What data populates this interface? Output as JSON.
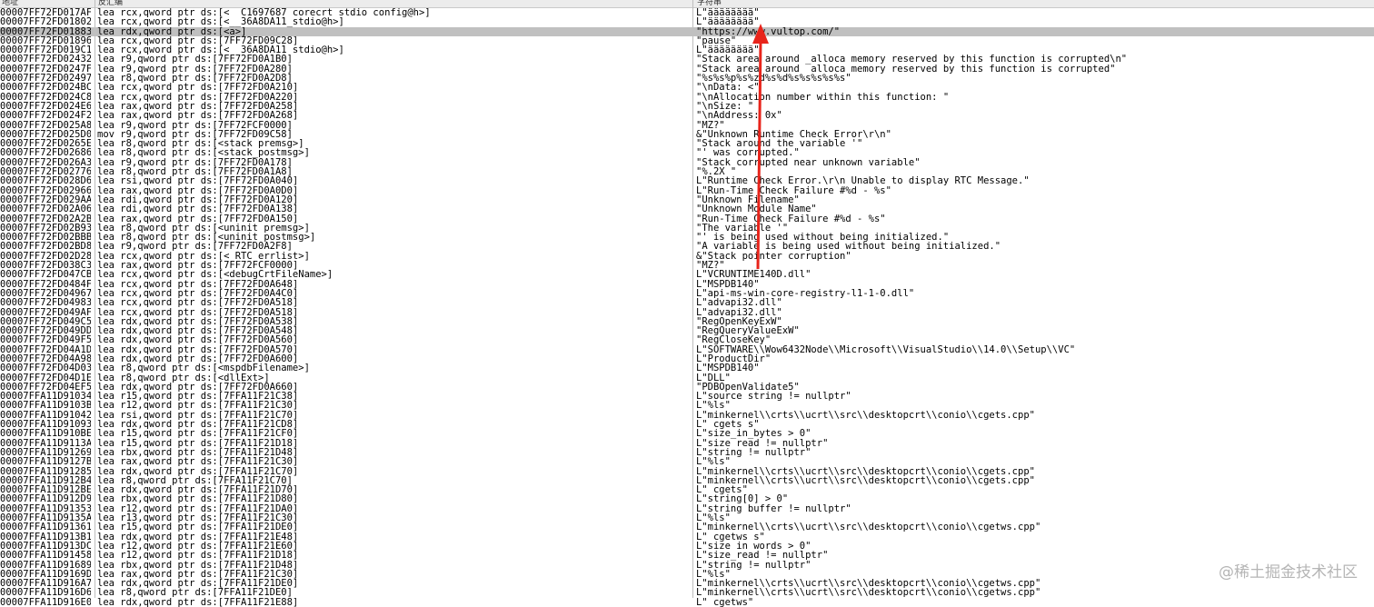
{
  "header": {
    "col_addr": "地址",
    "col_disasm": "反汇编",
    "col_string": "字符串"
  },
  "colors": {
    "selected_row": "#c0c0c0",
    "arrow": "#e8241b"
  },
  "selected_index": 2,
  "rows": [
    {
      "addr": "00007FF72FD017AF",
      "instr": "lea rcx,qword ptr ds:[<__C1697687_corecrt_stdio_config@h>]",
      "str": "L\"ääääääää\""
    },
    {
      "addr": "00007FF72FD01802",
      "instr": "lea rcx,qword ptr ds:[<__36A8DA11_stdio@h>]",
      "str": "L\"ääääääää\""
    },
    {
      "addr": "00007FF72FD01883",
      "instr": "lea rdx,qword ptr ds:[<a>]",
      "str": "\"https://www.vultop.com/\""
    },
    {
      "addr": "00007FF72FD01896",
      "instr": "lea rcx,qword ptr ds:[7FF72FD09C28]",
      "str": "\"pause\""
    },
    {
      "addr": "00007FF72FD019C1",
      "instr": "lea rcx,qword ptr ds:[<__36A8DA11_stdio@h>]",
      "str": "L\"ääääääää\""
    },
    {
      "addr": "00007FF72FD02432",
      "instr": "lea r9,qword ptr ds:[7FF72FD0A1B0]",
      "str": "\"Stack area around _alloca memory reserved by this function is corrupted\\n\""
    },
    {
      "addr": "00007FF72FD0247F",
      "instr": "lea r9,qword ptr ds:[7FF72FD0A280]",
      "str": "\"Stack area around _alloca memory reserved by this function is corrupted\""
    },
    {
      "addr": "00007FF72FD02497",
      "instr": "lea r8,qword ptr ds:[7FF72FD0A2D8]",
      "str": "\"%s%s%p%s%zd%s%d%s%s%s%s%s\""
    },
    {
      "addr": "00007FF72FD024BC",
      "instr": "lea rcx,qword ptr ds:[7FF72FD0A210]",
      "str": "\"\\nData: <\""
    },
    {
      "addr": "00007FF72FD024C8",
      "instr": "lea rcx,qword ptr ds:[7FF72FD0A220]",
      "str": "\"\\nAllocation number within this function: \""
    },
    {
      "addr": "00007FF72FD024E6",
      "instr": "lea rax,qword ptr ds:[7FF72FD0A258]",
      "str": "\"\\nSize: \""
    },
    {
      "addr": "00007FF72FD024F2",
      "instr": "lea rax,qword ptr ds:[7FF72FD0A268]",
      "str": "\"\\nAddress: 0x\""
    },
    {
      "addr": "00007FF72FD025A8",
      "instr": "lea r9,qword ptr ds:[7FF72FCF0000]",
      "str": "\"MZ?\""
    },
    {
      "addr": "00007FF72FD025D0",
      "instr": "mov r9,qword ptr ds:[7FF72FD09C58]",
      "str": "&\"Unknown Runtime Check Error\\r\\n\""
    },
    {
      "addr": "00007FF72FD0265E",
      "instr": "lea r8,qword ptr ds:[<stack_premsg>]",
      "str": "\"Stack around the variable '\""
    },
    {
      "addr": "00007FF72FD02686",
      "instr": "lea r8,qword ptr ds:[<stack_postmsg>]",
      "str": "\"' was corrupted.\""
    },
    {
      "addr": "00007FF72FD026A3",
      "instr": "lea r9,qword ptr ds:[7FF72FD0A178]",
      "str": "\"Stack corrupted near unknown variable\""
    },
    {
      "addr": "00007FF72FD02776",
      "instr": "lea r8,qword ptr ds:[7FF72FD0A1A8]",
      "str": "\"%.2X \""
    },
    {
      "addr": "00007FF72FD028D6",
      "instr": "lea rsi,qword ptr ds:[7FF72FD0A040]",
      "str": "L\"Runtime Check Error.\\r\\n Unable to display RTC Message.\""
    },
    {
      "addr": "00007FF72FD02966",
      "instr": "lea rax,qword ptr ds:[7FF72FD0A0D0]",
      "str": "L\"Run-Time Check Failure #%d - %s\""
    },
    {
      "addr": "00007FF72FD029AA",
      "instr": "lea rdi,qword ptr ds:[7FF72FD0A120]",
      "str": "\"Unknown Filename\""
    },
    {
      "addr": "00007FF72FD02A06",
      "instr": "lea rdi,qword ptr ds:[7FF72FD0A138]",
      "str": "\"Unknown Module Name\""
    },
    {
      "addr": "00007FF72FD02A2B",
      "instr": "lea rax,qword ptr ds:[7FF72FD0A150]",
      "str": "\"Run-Time Check Failure #%d - %s\""
    },
    {
      "addr": "00007FF72FD02B93",
      "instr": "lea r8,qword ptr ds:[<uninit_premsg>]",
      "str": "\"The variable '\""
    },
    {
      "addr": "00007FF72FD02BBB",
      "instr": "lea r8,qword ptr ds:[<uninit_postmsg>]",
      "str": "\"' is being used without being initialized.\""
    },
    {
      "addr": "00007FF72FD02BD8",
      "instr": "lea r9,qword ptr ds:[7FF72FD0A2F8]",
      "str": "\"A variable is being used without being initialized.\""
    },
    {
      "addr": "00007FF72FD02D28",
      "instr": "lea rcx,qword ptr ds:[<_RTC_errlist>]",
      "str": "&\"Stack pointer corruption\""
    },
    {
      "addr": "00007FF72FD038C3",
      "instr": "lea rax,qword ptr ds:[7FF72FCF0000]",
      "str": "\"MZ?\""
    },
    {
      "addr": "00007FF72FD047CB",
      "instr": "lea rcx,qword ptr ds:[<debugCrtFileName>]",
      "str": "L\"VCRUNTIME140D.dll\""
    },
    {
      "addr": "00007FF72FD0484F",
      "instr": "lea rcx,qword ptr ds:[7FF72FD0A648]",
      "str": "L\"MSPDB140\""
    },
    {
      "addr": "00007FF72FD04967",
      "instr": "lea rcx,qword ptr ds:[7FF72FD0A4C0]",
      "str": "L\"api-ms-win-core-registry-l1-1-0.dll\""
    },
    {
      "addr": "00007FF72FD04983",
      "instr": "lea rcx,qword ptr ds:[7FF72FD0A518]",
      "str": "L\"advapi32.dll\""
    },
    {
      "addr": "00007FF72FD049AF",
      "instr": "lea rcx,qword ptr ds:[7FF72FD0A518]",
      "str": "L\"advapi32.dll\""
    },
    {
      "addr": "00007FF72FD049C5",
      "instr": "lea rdx,qword ptr ds:[7FF72FD0A538]",
      "str": "\"RegOpenKeyExW\""
    },
    {
      "addr": "00007FF72FD049DD",
      "instr": "lea rdx,qword ptr ds:[7FF72FD0A548]",
      "str": "\"RegQueryValueExW\""
    },
    {
      "addr": "00007FF72FD049F5",
      "instr": "lea rdx,qword ptr ds:[7FF72FD0A560]",
      "str": "\"RegCloseKey\""
    },
    {
      "addr": "00007FF72FD04A1D",
      "instr": "lea rdx,qword ptr ds:[7FF72FD0A570]",
      "str": "L\"SOFTWARE\\\\Wow6432Node\\\\Microsoft\\\\VisualStudio\\\\14.0\\\\Setup\\\\VC\""
    },
    {
      "addr": "00007FF72FD04A98",
      "instr": "lea rdx,qword ptr ds:[7FF72FD0A600]",
      "str": "L\"ProductDir\""
    },
    {
      "addr": "00007FF72FD04D03",
      "instr": "lea r8,qword ptr ds:[<mspdbFilename>]",
      "str": "L\"MSPDB140\""
    },
    {
      "addr": "00007FF72FD04D1E",
      "instr": "lea r8,qword ptr ds:[<dllExt>]",
      "str": "L\"DLL\""
    },
    {
      "addr": "00007FF72FD04EF5",
      "instr": "lea rdx,qword ptr ds:[7FF72FD0A660]",
      "str": "\"PDBOpenValidate5\""
    },
    {
      "addr": "00007FFA11D91034",
      "instr": "lea r15,qword ptr ds:[7FFA11F21C38]",
      "str": "L\"source_string != nullptr\""
    },
    {
      "addr": "00007FFA11D9103B",
      "instr": "lea r12,qword ptr ds:[7FFA11F21C30]",
      "str": "L\"%ls\""
    },
    {
      "addr": "00007FFA11D91042",
      "instr": "lea rsi,qword ptr ds:[7FFA11F21C70]",
      "str": "L\"minkernel\\\\crts\\\\ucrt\\\\src\\\\desktopcrt\\\\conio\\\\cgets.cpp\""
    },
    {
      "addr": "00007FFA11D91093",
      "instr": "lea rdx,qword ptr ds:[7FFA11F21CD8]",
      "str": "L\"_cgets_s\""
    },
    {
      "addr": "00007FFA11D910BE",
      "instr": "lea r15,qword ptr ds:[7FFA11F21CF0]",
      "str": "L\"size_in_bytes > 0\""
    },
    {
      "addr": "00007FFA11D9113A",
      "instr": "lea r15,qword ptr ds:[7FFA11F21D18]",
      "str": "L\"size_read != nullptr\""
    },
    {
      "addr": "00007FFA11D91269",
      "instr": "lea rbx,qword ptr ds:[7FFA11F21D48]",
      "str": "L\"string != nullptr\""
    },
    {
      "addr": "00007FFA11D9127B",
      "instr": "lea rax,qword ptr ds:[7FFA11F21C30]",
      "str": "L\"%ls\""
    },
    {
      "addr": "00007FFA11D91285",
      "instr": "lea rdx,qword ptr ds:[7FFA11F21C70]",
      "str": "L\"minkernel\\\\crts\\\\ucrt\\\\src\\\\desktopcrt\\\\conio\\\\cgets.cpp\""
    },
    {
      "addr": "00007FFA11D912B4",
      "instr": "lea r8,qword ptr ds:[7FFA11F21C70]",
      "str": "L\"minkernel\\\\crts\\\\ucrt\\\\src\\\\desktopcrt\\\\conio\\\\cgets.cpp\""
    },
    {
      "addr": "00007FFA11D912BE",
      "instr": "lea rdx,qword ptr ds:[7FFA11F21D70]",
      "str": "L\"_cgets\""
    },
    {
      "addr": "00007FFA11D912D9",
      "instr": "lea rbx,qword ptr ds:[7FFA11F21D80]",
      "str": "L\"string[0] > 0\""
    },
    {
      "addr": "00007FFA11D91353",
      "instr": "lea r12,qword ptr ds:[7FFA11F21DA0]",
      "str": "L\"string_buffer != nullptr\""
    },
    {
      "addr": "00007FFA11D9135A",
      "instr": "lea r13,qword ptr ds:[7FFA11F21C30]",
      "str": "L\"%ls\""
    },
    {
      "addr": "00007FFA11D91361",
      "instr": "lea r15,qword ptr ds:[7FFA11F21DE0]",
      "str": "L\"minkernel\\\\crts\\\\ucrt\\\\src\\\\desktopcrt\\\\conio\\\\cgetws.cpp\""
    },
    {
      "addr": "00007FFA11D913B1",
      "instr": "lea rdx,qword ptr ds:[7FFA11F21E48]",
      "str": "L\"_cgetws_s\""
    },
    {
      "addr": "00007FFA11D913DC",
      "instr": "lea r12,qword ptr ds:[7FFA11F21E60]",
      "str": "L\"size_in_words > 0\""
    },
    {
      "addr": "00007FFA11D91458",
      "instr": "lea r12,qword ptr ds:[7FFA11F21D18]",
      "str": "L\"size_read != nullptr\""
    },
    {
      "addr": "00007FFA11D91689",
      "instr": "lea rbx,qword ptr ds:[7FFA11F21D48]",
      "str": "L\"string != nullptr\""
    },
    {
      "addr": "00007FFA11D9169D",
      "instr": "lea rax,qword ptr ds:[7FFA11F21C30]",
      "str": "L\"%ls\""
    },
    {
      "addr": "00007FFA11D916A7",
      "instr": "lea rdx,qword ptr ds:[7FFA11F21DE0]",
      "str": "L\"minkernel\\\\crts\\\\ucrt\\\\src\\\\desktopcrt\\\\conio\\\\cgetws.cpp\""
    },
    {
      "addr": "00007FFA11D916D6",
      "instr": "lea r8,qword ptr ds:[7FFA11F21DE0]",
      "str": "L\"minkernel\\\\crts\\\\ucrt\\\\src\\\\desktopcrt\\\\conio\\\\cgetws.cpp\""
    },
    {
      "addr": "00007FFA11D916E0",
      "instr": "lea rdx,qword ptr ds:[7FFA11F21E88]",
      "str": "L\"_cgetws\""
    }
  ],
  "watermark": "@稀土掘金技术社区"
}
